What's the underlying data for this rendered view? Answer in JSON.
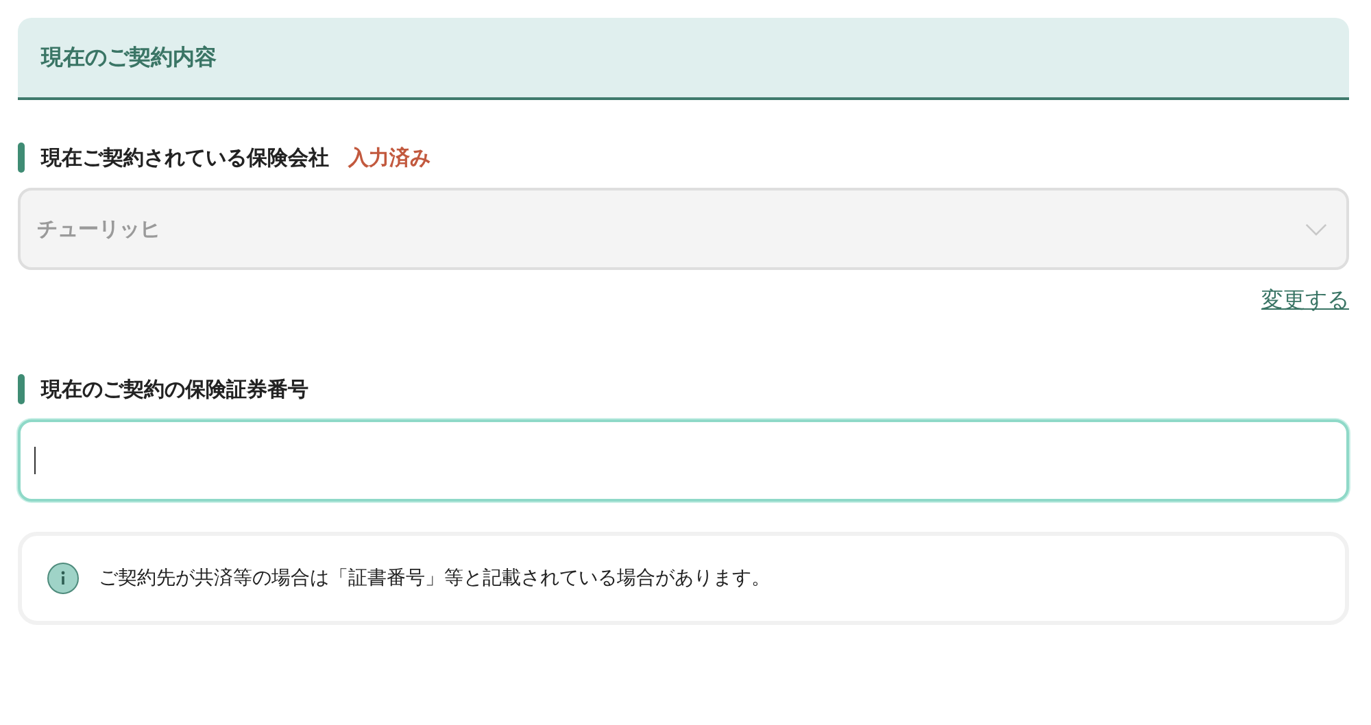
{
  "section": {
    "title": "現在のご契約内容"
  },
  "fields": [
    {
      "kind": "select",
      "label": "現在ご契約されている保険会社",
      "status": "入力済み",
      "value": "チューリッヒ",
      "disabled": true,
      "link": "変更する"
    },
    {
      "kind": "text",
      "label": "現在のご契約の保険証券番号",
      "focused": true
    }
  ],
  "note": {
    "text": "ご契約先が共済等の場合は「証書番号」等と記載されている場合があります。"
  }
}
